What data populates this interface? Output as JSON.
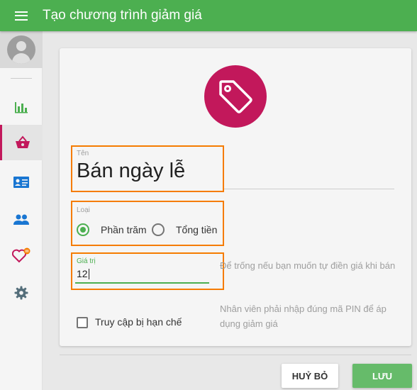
{
  "header": {
    "title": "Tạo chương trình giảm giá"
  },
  "sidebar": {
    "items": [
      {
        "icon": "bar-chart-icon",
        "active": false
      },
      {
        "icon": "basket-icon",
        "active": true
      },
      {
        "icon": "id-card-icon",
        "active": false
      },
      {
        "icon": "people-icon",
        "active": false
      },
      {
        "icon": "heart-icon",
        "active": false
      },
      {
        "icon": "gear-icon",
        "active": false
      }
    ]
  },
  "form": {
    "name": {
      "label": "Tên",
      "value": "Bán ngày lễ"
    },
    "type": {
      "label": "Loại",
      "options": [
        {
          "label": "Phần trăm",
          "checked": true
        },
        {
          "label": "Tổng tiền",
          "checked": false
        }
      ]
    },
    "value": {
      "label": "Giá trị",
      "value": "12",
      "hint": "Để trống nếu bạn muốn tự điền giá khi bán"
    },
    "restricted": {
      "label": "Truy cập bị hạn chế",
      "checked": false,
      "hint": "Nhân viên phải nhập đúng mã PIN để áp dụng giảm giá"
    }
  },
  "actions": {
    "cancel_label": "HUỶ BỎ",
    "save_label": "LƯU"
  },
  "colors": {
    "app_bar": "#4caf50",
    "accent": "#c2185b",
    "highlight_border": "#f57c00",
    "save_button": "#66bb6a"
  }
}
